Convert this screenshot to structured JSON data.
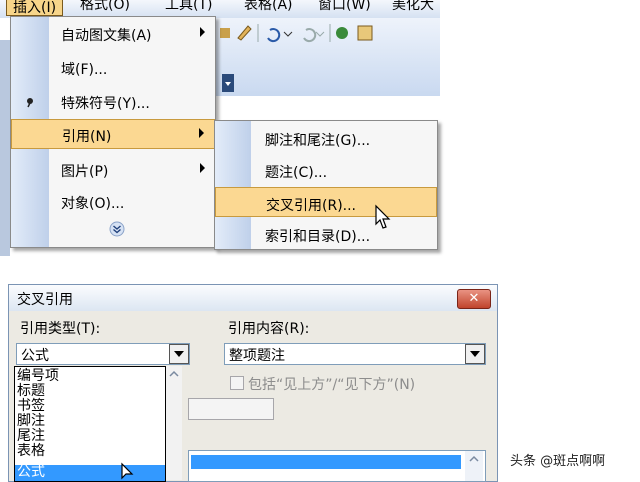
{
  "menubar": {
    "items": [
      "插入(I)",
      "格式(O)",
      "工具(T)",
      "表格(A)",
      "窗口(W)",
      "美化大"
    ]
  },
  "insert_menu": {
    "items": [
      {
        "label": "自动图文集(A)",
        "submenu": true
      },
      {
        "label": "域(F)...",
        "submenu": false
      },
      {
        "label": "特殊符号(Y)...",
        "submenu": false
      },
      {
        "label": "引用(N)",
        "submenu": true,
        "highlighted": true
      },
      {
        "label": "图片(P)",
        "submenu": true
      },
      {
        "label": "对象(O)...",
        "submenu": false
      }
    ]
  },
  "reference_submenu": {
    "items": [
      {
        "label": "脚注和尾注(G)..."
      },
      {
        "label": "题注(C)..."
      },
      {
        "label": "交叉引用(R)...",
        "highlighted": true
      },
      {
        "label": "索引和目录(D)..."
      }
    ]
  },
  "dialog": {
    "title": "交叉引用",
    "close_symbol": "✕",
    "ref_type_label": "引用类型(T):",
    "ref_type_value": "公式",
    "ref_content_label": "引用内容(R):",
    "ref_content_value": "整项题注",
    "include_label": "包括“见上方”/“见下方”(N)",
    "type_options": [
      "编号项",
      "标题",
      "书签",
      "脚注",
      "尾注",
      "表格",
      "公式"
    ],
    "selected_type": "公式"
  },
  "watermark": "头条 @斑点啊啊",
  "colors": {
    "menu_highlight": "#fbd892",
    "list_selection": "#3399ff",
    "close_button": "#c0442c"
  }
}
